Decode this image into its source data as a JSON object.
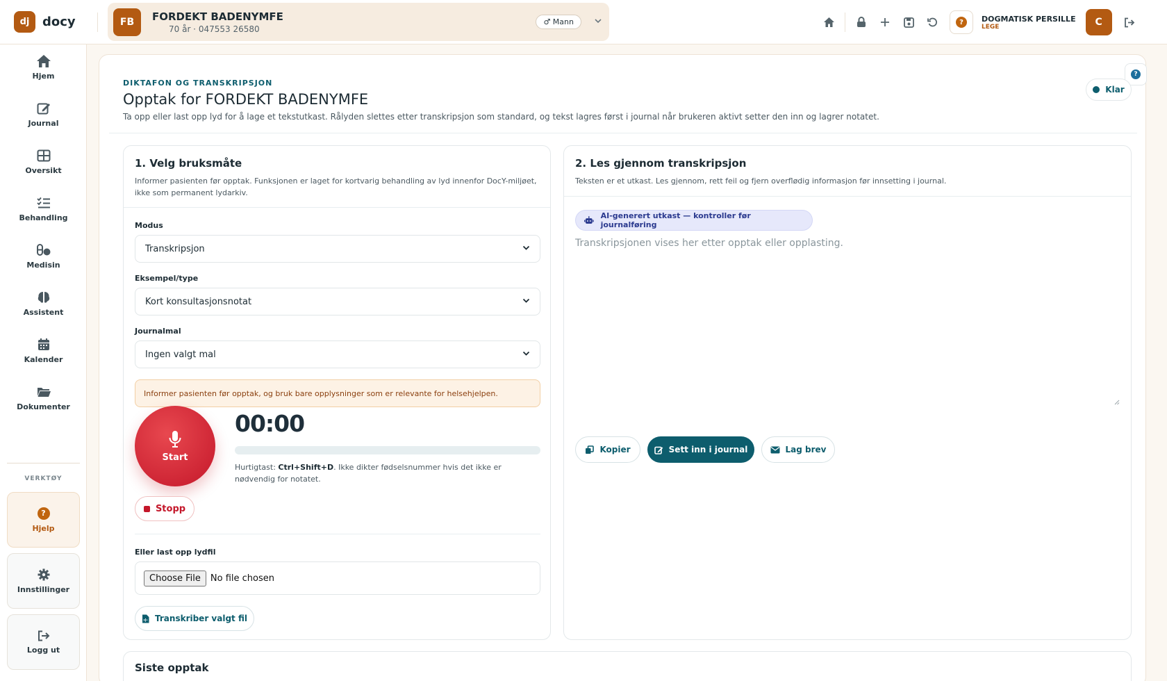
{
  "brand": {
    "logo_text": "dj",
    "name": "docy"
  },
  "patient": {
    "initials": "FB",
    "name": "FORDEKT BADENYMFE",
    "details": "70 år · 047553 26580",
    "gender": "♂ Mann"
  },
  "user": {
    "name": "DOGMATISK PERSILLE",
    "role": "LEGE",
    "initial": "C"
  },
  "sidebar": {
    "items": [
      {
        "label": "Hjem",
        "icon": "home-icon"
      },
      {
        "label": "Journal",
        "icon": "edit-icon"
      },
      {
        "label": "Oversikt",
        "icon": "grid-icon"
      },
      {
        "label": "Behandling",
        "icon": "list-check-icon"
      },
      {
        "label": "Medisin",
        "icon": "pills-icon"
      },
      {
        "label": "Assistent",
        "icon": "brain-icon"
      },
      {
        "label": "Kalender",
        "icon": "calendar-icon"
      },
      {
        "label": "Dokumenter",
        "icon": "folder-icon"
      }
    ],
    "tools_label": "VERKTØY",
    "tools": [
      {
        "label": "Hjelp",
        "icon": "question-icon"
      },
      {
        "label": "Innstillinger",
        "icon": "gear-icon"
      },
      {
        "label": "Logg ut",
        "icon": "logout-icon"
      }
    ]
  },
  "page": {
    "eyebrow": "DIKTAFON OG TRANSKRIPSJON",
    "title": "Opptak for FORDEKT BADENYMFE",
    "subtitle": "Ta opp eller last opp lyd for å lage et tekstutkast. Rålyden slettes etter transkripsjon som standard, og tekst lagres først i journal når brukeren aktivt setter den inn og lagrer notatet.",
    "status": "Klar"
  },
  "panel1": {
    "title": "1. Velg bruksmåte",
    "description": "Informer pasienten før opptak. Funksjonen er laget for kortvarig behandling av lyd innenfor DocY-miljøet, ikke som permanent lydarkiv.",
    "mode_label": "Modus",
    "mode_value": "Transkripsjon",
    "type_label": "Eksempel/type",
    "type_value": "Kort konsultasjonsnotat",
    "template_label": "Journalmal",
    "template_value": "Ingen valgt mal",
    "warning": "Informer pasienten før opptak, og bruk bare opplysninger som er relevante for helsehjelpen.",
    "record_label": "Start",
    "timer": "00:00",
    "progress": 0,
    "hint_prefix": "Hurtigtast: ",
    "hint_shortcut": "Ctrl+Shift+D",
    "hint_suffix": ". Ikke dikter fødselsnummer hvis det ikke er nødvendig for notatet.",
    "stop_label": "Stopp",
    "upload_label": "Eller last opp lydfil",
    "choose_file": "Choose File",
    "no_file": "No file chosen",
    "transcribe_label": "Transkriber valgt fil"
  },
  "panel2": {
    "title": "2. Les gjennom transkripsjon",
    "description": "Teksten er et utkast. Les gjennom, rett feil og fjern overflødig informasjon før innsetting i journal.",
    "ai_badge": "AI-generert utkast — kontroller før journalføring",
    "transcript_placeholder": "Transkripsjonen vises her etter opptak eller opplasting.",
    "copy_label": "Kopier",
    "insert_label": "Sett inn i journal",
    "letter_label": "Lag brev"
  },
  "panel3": {
    "title": "Siste opptak"
  },
  "colors": {
    "accent": "#0d5d6d",
    "brand": "#b35a12",
    "record": "#c4172a"
  }
}
